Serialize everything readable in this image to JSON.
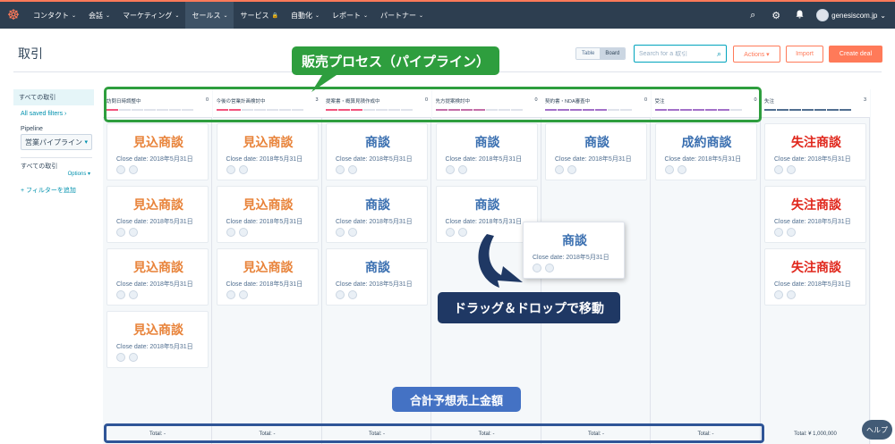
{
  "topnav": {
    "logo": "☸",
    "items": [
      {
        "label": "コンタクト",
        "caret": "⌄"
      },
      {
        "label": "会話",
        "caret": "⌄"
      },
      {
        "label": "マーケティング",
        "caret": "⌄"
      },
      {
        "label": "セールス",
        "caret": "⌄"
      },
      {
        "label": "サービス",
        "caret": "🔒"
      },
      {
        "label": "自動化",
        "caret": "⌄"
      },
      {
        "label": "レポート",
        "caret": "⌄"
      },
      {
        "label": "パートナー",
        "caret": "⌄"
      }
    ],
    "icons": {
      "search": "⌕",
      "settings": "⚙",
      "notifications": "♪"
    },
    "account": "genesiscom.jp",
    "account_caret": "⌄"
  },
  "header": {
    "title": "取引",
    "view_table": "Table",
    "view_board": "Board",
    "search_placeholder": "Search for a 取引",
    "actions_label": "Actions ▾",
    "import_label": "Import",
    "create_label": "Create deal"
  },
  "sidebar": {
    "all_deals": "すべての取引",
    "saved_filters": "All saved filters ›",
    "pipeline_label": "Pipeline",
    "pipeline_value": "営業パイプライン",
    "pipeline_caret": "▾",
    "all_deals_2": "すべての取引",
    "options": "Options ▾",
    "add_filter": "+ フィルターを追加"
  },
  "columns": [
    {
      "name": "訪問日時調整中",
      "count": "0",
      "total": "Total: -",
      "bar_color": "#f2547d",
      "cards": [
        {
          "title": "見込商談",
          "date": "Close date: 2018年5月31日",
          "color": "orange"
        },
        {
          "title": "見込商談",
          "date": "Close date: 2018年5月31日",
          "color": "orange"
        },
        {
          "title": "見込商談",
          "date": "Close date: 2018年5月31日",
          "color": "orange"
        },
        {
          "title": "見込商談",
          "date": "Close date: 2018年5月31日",
          "color": "orange"
        }
      ]
    },
    {
      "name": "今後の営業計画検討中",
      "count": "3",
      "total": "Total: -",
      "bar_color": "#f2547d",
      "cards": [
        {
          "title": "見込商談",
          "date": "Close date: 2018年5月31日",
          "color": "orange"
        },
        {
          "title": "見込商談",
          "date": "Close date: 2018年5月31日",
          "color": "orange"
        },
        {
          "title": "見込商談",
          "date": "Close date: 2018年5月31日",
          "color": "orange"
        }
      ]
    },
    {
      "name": "提案書・概算見積作成中",
      "count": "0",
      "total": "Total: -",
      "bar_color": "#f2547d",
      "cards": [
        {
          "title": "商談",
          "date": "Close date: 2018年5月31日",
          "color": "blue"
        },
        {
          "title": "商談",
          "date": "Close date: 2018年5月31日",
          "color": "blue"
        },
        {
          "title": "商談",
          "date": "Close date: 2018年5月31日",
          "color": "blue"
        }
      ]
    },
    {
      "name": "先方提案検討中",
      "count": "0",
      "total": "Total: -",
      "bar_color": "#c46fa8",
      "cards": [
        {
          "title": "商談",
          "date": "Close date: 2018年5月31日",
          "color": "blue"
        },
        {
          "title": "商談",
          "date": "Close date: 2018年5月31日",
          "color": "blue"
        }
      ]
    },
    {
      "name": "契約書・NDA審査中",
      "count": "0",
      "total": "Total: -",
      "bar_color": "#a371c9",
      "cards": [
        {
          "title": "商談",
          "date": "Close date: 2018年5月31日",
          "color": "blue"
        }
      ]
    },
    {
      "name": "受注",
      "count": "0",
      "total": "Total: -",
      "bar_color": "#a371c9",
      "cards": [
        {
          "title": "成約商談",
          "date": "Close date: 2018年5月31日",
          "color": "blue"
        }
      ]
    },
    {
      "name": "失注",
      "count": "3",
      "total": "Total: ¥ 1,000,000",
      "bar_color": "#516f90",
      "cards": [
        {
          "title": "失注商談",
          "date": "Close date: 2018年5月31日",
          "color": "red"
        },
        {
          "title": "失注商談",
          "date": "Close date: 2018年5月31日",
          "color": "red"
        },
        {
          "title": "失注商談",
          "date": "Close date: 2018年5月31日",
          "color": "red"
        }
      ]
    }
  ],
  "drag_card": {
    "title": "商談",
    "date": "Close date: 2018年5月31日"
  },
  "annotations": {
    "pipeline": "販売プロセス（パイプライン）",
    "drag": "ドラッグ＆ドロップで移動",
    "total": "合計予想売上金額"
  },
  "help": "ヘルプ",
  "colors": {
    "accent": "#ff7a59",
    "nav_bg": "#2d3e50",
    "green": "#2e9e3e",
    "navy": "#1f3864",
    "blue": "#4472c4"
  }
}
